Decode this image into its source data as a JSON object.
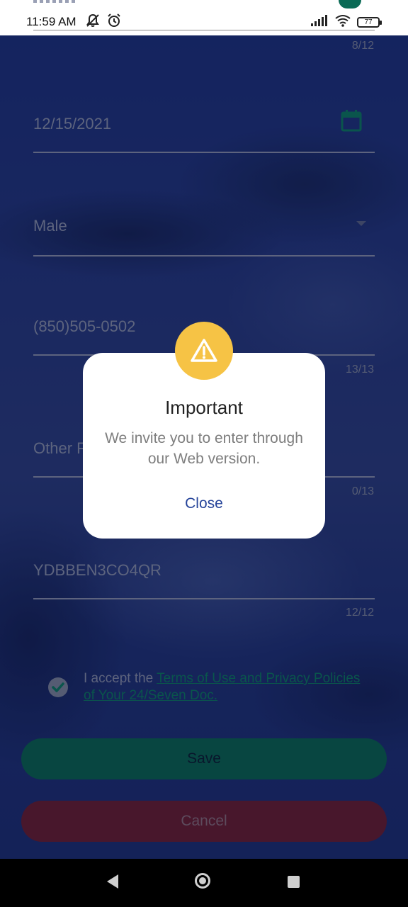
{
  "status_bar": {
    "time": "11:59 AM",
    "battery_level": "77",
    "icons": [
      "mute-icon",
      "alarm-icon",
      "signal-icon",
      "wifi-icon",
      "battery-icon"
    ]
  },
  "form": {
    "first_counter": "8/12",
    "date_value": "12/15/2021",
    "gender_value": "Male",
    "phone_value": "(850)505-0502",
    "phone_counter": "13/13",
    "other_phone_value": "Other F",
    "other_phone_counter": "0/13",
    "code_value": "YDBBEN3CO4QR",
    "code_counter": "12/12",
    "terms_prefix": "I accept the ",
    "terms_link": "Terms of Use and Privacy Policies of Your 24/Seven Doc.",
    "save_label": "Save",
    "cancel_label": "Cancel"
  },
  "modal": {
    "title": "Important",
    "message": "We invite you to enter through our Web version.",
    "close_label": "Close"
  },
  "colors": {
    "accent_green": "#08634b",
    "cancel_red": "#6a1b2a",
    "warning_yellow": "#f6c345",
    "link_blue": "#26449a"
  }
}
